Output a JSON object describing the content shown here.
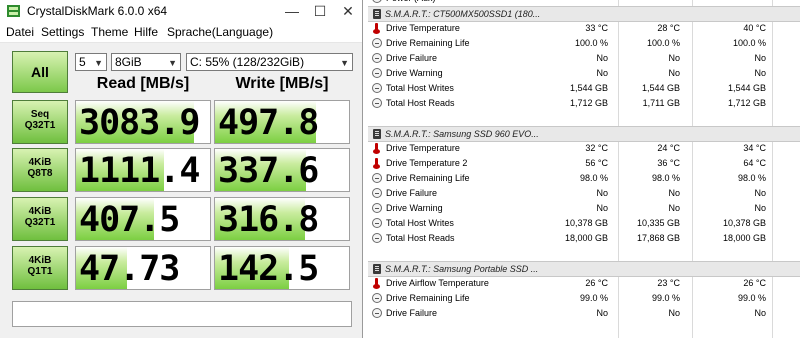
{
  "window": {
    "title": "CrystalDiskMark 6.0.0 x64",
    "controls": {
      "minimize": "—",
      "maximize": "☐",
      "close": "✕"
    }
  },
  "menu": [
    "Datei",
    "Settings",
    "Theme",
    "Hilfe",
    "Sprache(Language)"
  ],
  "controls": {
    "all_label": "All",
    "count": "5",
    "size": "8GiB",
    "drive": "C: 55% (128/232GiB)"
  },
  "columns": {
    "read": "Read [MB/s]",
    "write": "Write [MB/s]"
  },
  "tests": [
    {
      "line1": "Seq",
      "line2": "Q32T1",
      "read": "3083.9",
      "write": "497.8",
      "read_fill": 0.88,
      "write_fill": 0.75
    },
    {
      "line1": "4KiB",
      "line2": "Q8T8",
      "read": "1111.4",
      "write": "337.6",
      "read_fill": 0.66,
      "write_fill": 0.68
    },
    {
      "line1": "4KiB",
      "line2": "Q32T1",
      "read": "407.5",
      "write": "316.8",
      "read_fill": 0.58,
      "write_fill": 0.67
    },
    {
      "line1": "4KiB",
      "line2": "Q1T1",
      "read": "47.73",
      "write": "142.5",
      "read_fill": 0.38,
      "write_fill": 0.55
    }
  ],
  "comment": "",
  "hwinfo": {
    "rows": [
      {
        "type": "data",
        "icon": "minus-icon",
        "name": "Power (Aux)",
        "v1": "",
        "v2": "",
        "v3": ""
      },
      {
        "type": "header",
        "icon": "disk-icon",
        "name": "S.M.A.R.T.: CT500MX500SSD1 (180..."
      },
      {
        "type": "data",
        "icon": "thermometer-icon",
        "name": "Drive Temperature",
        "v1": "33 °C",
        "v2": "28 °C",
        "v3": "40 °C"
      },
      {
        "type": "data",
        "icon": "minus-icon",
        "name": "Drive Remaining Life",
        "v1": "100.0 %",
        "v2": "100.0 %",
        "v3": "100.0 %"
      },
      {
        "type": "data",
        "icon": "minus-icon",
        "name": "Drive Failure",
        "v1": "No",
        "v2": "No",
        "v3": "No"
      },
      {
        "type": "data",
        "icon": "minus-icon",
        "name": "Drive Warning",
        "v1": "No",
        "v2": "No",
        "v3": "No"
      },
      {
        "type": "data",
        "icon": "minus-icon",
        "name": "Total Host Writes",
        "v1": "1,544 GB",
        "v2": "1,544 GB",
        "v3": "1,544 GB"
      },
      {
        "type": "data",
        "icon": "minus-icon",
        "name": "Total Host Reads",
        "v1": "1,712 GB",
        "v2": "1,711 GB",
        "v3": "1,712 GB"
      },
      {
        "type": "spacer"
      },
      {
        "type": "header",
        "icon": "disk-icon",
        "name": "S.M.A.R.T.: Samsung SSD 960 EVO..."
      },
      {
        "type": "data",
        "icon": "thermometer-icon",
        "name": "Drive Temperature",
        "v1": "32 °C",
        "v2": "24 °C",
        "v3": "34 °C"
      },
      {
        "type": "data",
        "icon": "thermometer-icon",
        "name": "Drive Temperature 2",
        "v1": "56 °C",
        "v2": "36 °C",
        "v3": "64 °C"
      },
      {
        "type": "data",
        "icon": "minus-icon",
        "name": "Drive Remaining Life",
        "v1": "98.0 %",
        "v2": "98.0 %",
        "v3": "98.0 %"
      },
      {
        "type": "data",
        "icon": "minus-icon",
        "name": "Drive Failure",
        "v1": "No",
        "v2": "No",
        "v3": "No"
      },
      {
        "type": "data",
        "icon": "minus-icon",
        "name": "Drive Warning",
        "v1": "No",
        "v2": "No",
        "v3": "No"
      },
      {
        "type": "data",
        "icon": "minus-icon",
        "name": "Total Host Writes",
        "v1": "10,378 GB",
        "v2": "10,335 GB",
        "v3": "10,378 GB"
      },
      {
        "type": "data",
        "icon": "minus-icon",
        "name": "Total Host Reads",
        "v1": "18,000 GB",
        "v2": "17,868 GB",
        "v3": "18,000 GB"
      },
      {
        "type": "spacer"
      },
      {
        "type": "header",
        "icon": "disk-icon",
        "name": "S.M.A.R.T.: Samsung Portable SSD ..."
      },
      {
        "type": "data",
        "icon": "thermometer-icon",
        "name": "Drive Airflow Temperature",
        "v1": "26 °C",
        "v2": "23 °C",
        "v3": "26 °C"
      },
      {
        "type": "data",
        "icon": "minus-icon",
        "name": "Drive Remaining Life",
        "v1": "99.0 %",
        "v2": "99.0 %",
        "v3": "99.0 %"
      },
      {
        "type": "data",
        "icon": "minus-icon",
        "name": "Drive Failure",
        "v1": "No",
        "v2": "No",
        "v3": "No"
      }
    ]
  }
}
